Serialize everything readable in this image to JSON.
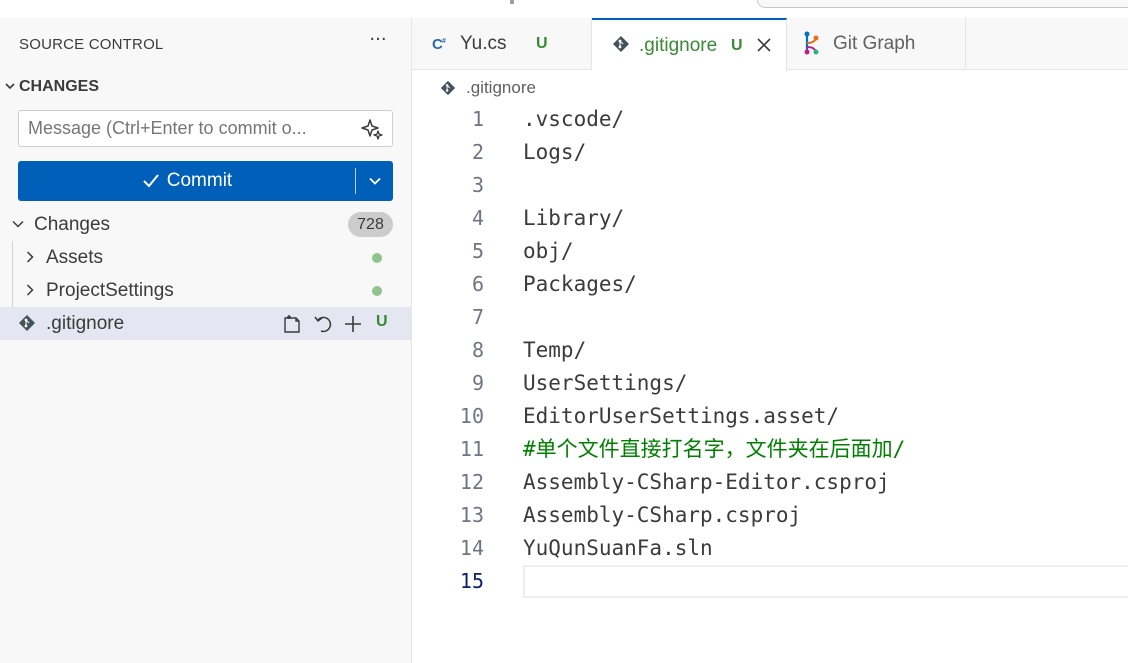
{
  "sidebar": {
    "title": "SOURCE CONTROL",
    "more_label": "···",
    "section_title": "CHANGES",
    "message_placeholder": "Message (Ctrl+Enter to commit o...",
    "commit_label": "Commit",
    "changes_group": {
      "label": "Changes",
      "count": "728"
    },
    "items": [
      {
        "label": "Assets",
        "icon": "chevron-right-icon",
        "status": "modified-dot"
      },
      {
        "label": "ProjectSettings",
        "icon": "chevron-right-icon",
        "status": "modified-dot"
      },
      {
        "label": ".gitignore",
        "icon": "git-file-icon",
        "status": "U"
      }
    ]
  },
  "tabs": [
    {
      "label": "Yu.cs",
      "icon": "csharp-file-icon",
      "status": "U"
    },
    {
      "label": ".gitignore",
      "icon": "git-file-icon",
      "status": "U",
      "active": true
    },
    {
      "label": "Git Graph",
      "icon": "git-graph-icon"
    }
  ],
  "breadcrumb": {
    "file": ".gitignore"
  },
  "editor": {
    "current_line": 15,
    "lines": [
      {
        "n": "1",
        "text": ".vscode/"
      },
      {
        "n": "2",
        "text": "Logs/"
      },
      {
        "n": "3",
        "text": ""
      },
      {
        "n": "4",
        "text": "Library/"
      },
      {
        "n": "5",
        "text": "obj/"
      },
      {
        "n": "6",
        "text": "Packages/"
      },
      {
        "n": "7",
        "text": ""
      },
      {
        "n": "8",
        "text": "Temp/"
      },
      {
        "n": "9",
        "text": "UserSettings/"
      },
      {
        "n": "10",
        "text": "EditorUserSettings.asset/"
      },
      {
        "n": "11",
        "text": "#单个文件直接打名字，文件夹在后面加/"
      },
      {
        "n": "12",
        "text": "Assembly-CSharp-Editor.csproj"
      },
      {
        "n": "13",
        "text": "Assembly-CSharp.csproj"
      },
      {
        "n": "14",
        "text": "YuQunSuanFa.sln"
      },
      {
        "n": "15",
        "text": ""
      }
    ]
  },
  "colors": {
    "accent": "#005fb8",
    "untracked": "#388a34",
    "comment": "#008000",
    "modified_dot": "#8fc38f"
  }
}
